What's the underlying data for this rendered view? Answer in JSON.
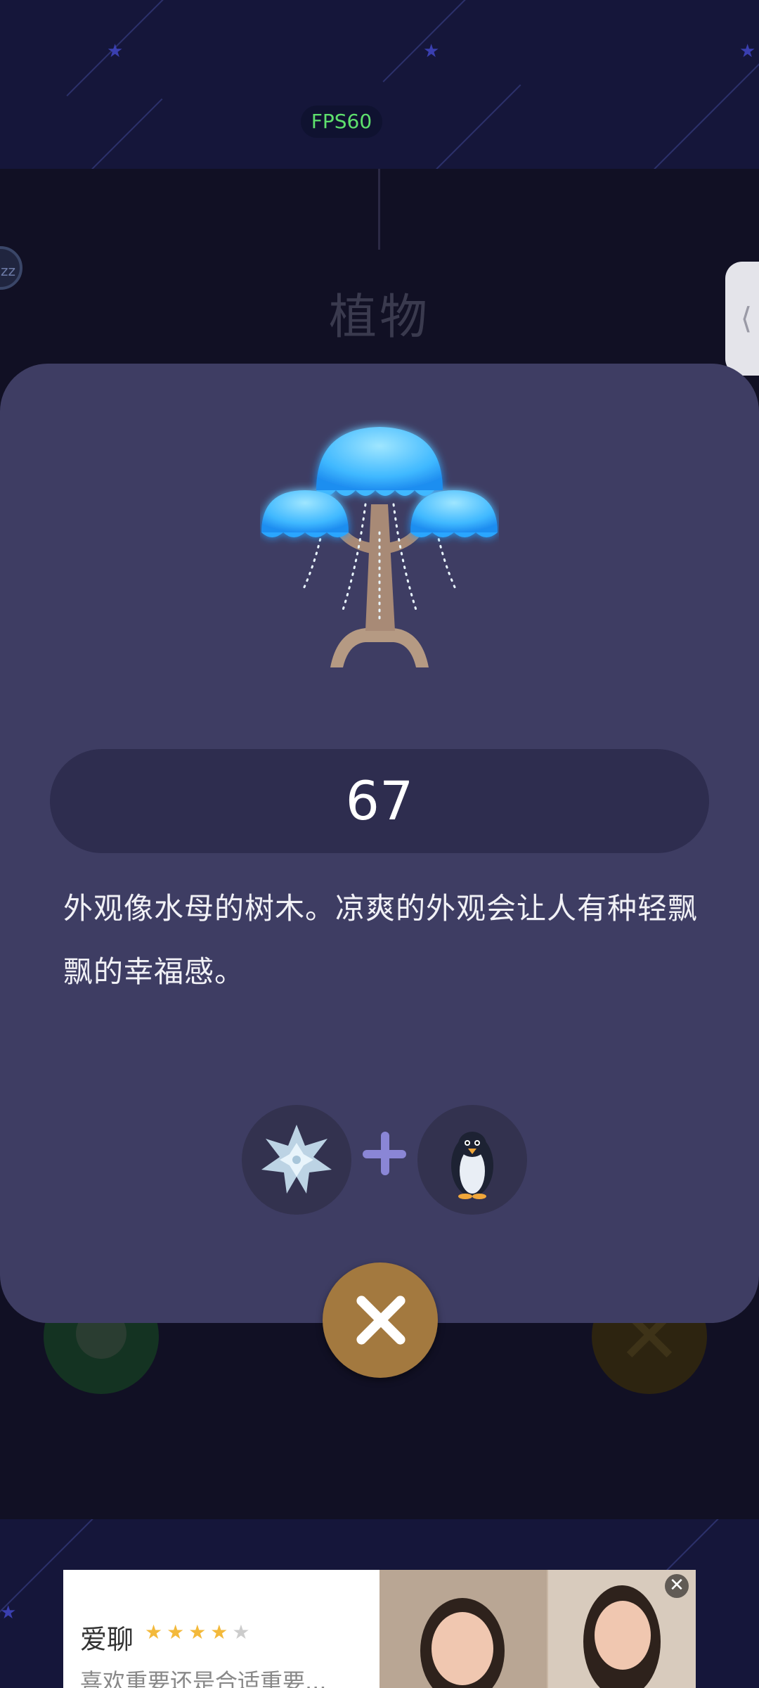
{
  "status": {
    "fps_label": "FPS60"
  },
  "background": {
    "category_title": "植物",
    "zz_badge": "zz",
    "side_tab_glyph": "⟨"
  },
  "dialog": {
    "item_icon": "jellyfish-tree-icon",
    "number": "67",
    "description": "外观像水母的树木。凉爽的外观会让人有种轻飘飘的幸福感。",
    "recipe": {
      "ingredient_a_icon": "snowflake-crystal-icon",
      "plus_icon": "plus-icon",
      "ingredient_b_icon": "penguin-icon"
    },
    "close_icon": "close-icon"
  },
  "ad": {
    "app_name": "爱聊",
    "rating": 4,
    "rating_max": 5,
    "subtitle": "喜欢重要还是合适重要...",
    "close_glyph": "✕"
  },
  "colors": {
    "dialog_bg": "#3e3d63",
    "pill_bg": "#2e2d4f",
    "close_button": "#a3793f",
    "fps_text": "#5ee06d",
    "accent_plus": "#8a86d6"
  }
}
